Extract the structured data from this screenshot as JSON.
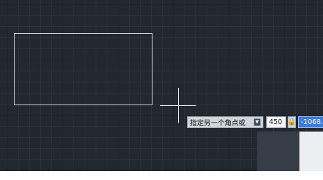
{
  "dynamic_input": {
    "prompt": "指定另一个角点或",
    "options_icon": "down-arrow-icon",
    "first_value": "450",
    "lock_icon": "lock-icon",
    "second_value": "-1068."
  },
  "colors": {
    "canvas": "#212830",
    "geometry": "#d7dbe0",
    "active_field": "#3d7bd9"
  }
}
